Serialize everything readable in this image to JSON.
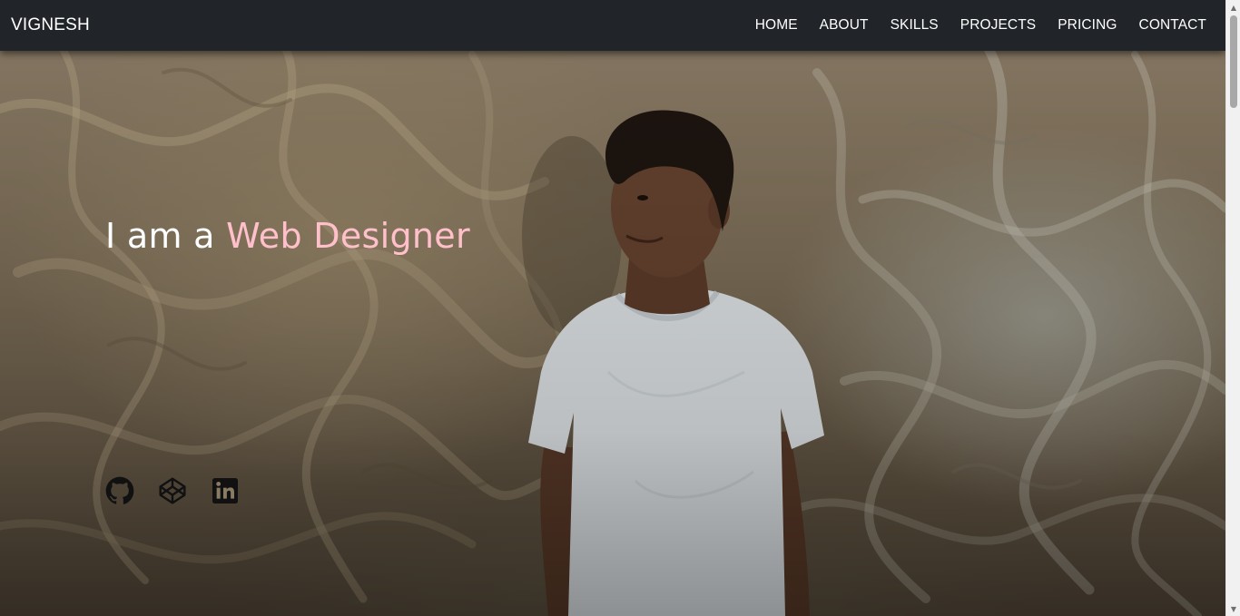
{
  "navbar": {
    "brand": "VIGNESH",
    "links": [
      "HOME",
      "ABOUT",
      "SKILLS",
      "PROJECTS",
      "PRICING",
      "CONTACT"
    ]
  },
  "hero": {
    "headline_prefix": "I am a ",
    "headline_role": "Web Designer"
  },
  "socials": [
    {
      "icon": "github-icon"
    },
    {
      "icon": "codepen-icon"
    },
    {
      "icon": "linkedin-icon"
    }
  ],
  "colors": {
    "navbar_bg": "#212529",
    "nav_text": "#ffffff",
    "accent_pink": "#ffc0cb",
    "icon_color": "#111111"
  },
  "scrollbar": {
    "up_arrow": "▲",
    "down_arrow": "▼"
  }
}
